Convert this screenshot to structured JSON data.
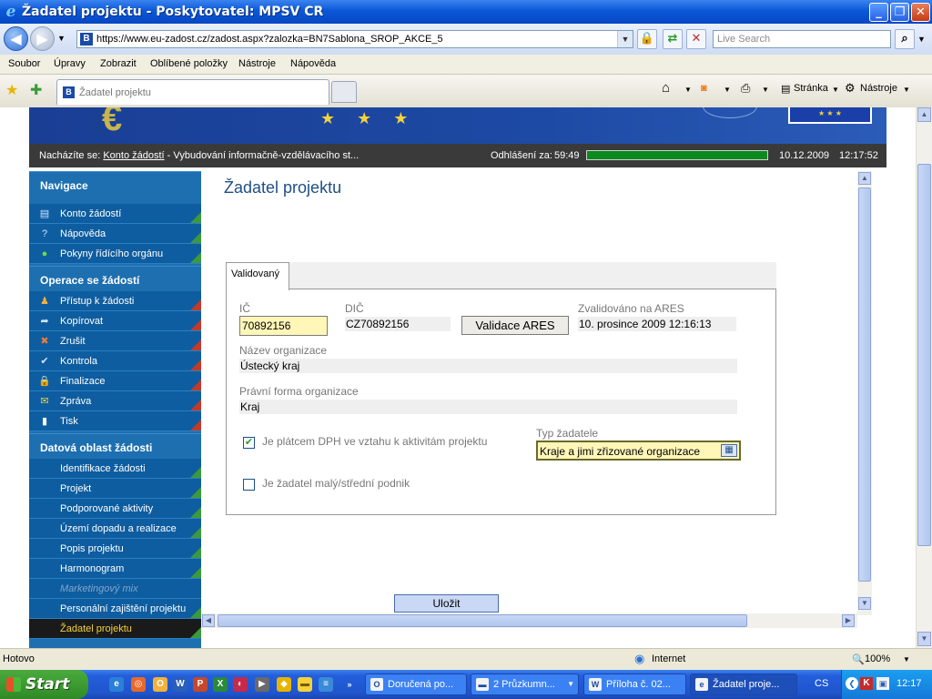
{
  "window": {
    "title": "Žadatel projektu - Poskytovatel: MPSV CR"
  },
  "address": {
    "url": "https://www.eu-zadost.cz/zadost.aspx?zalozka=BN7Sablona_SROP_AKCE_5",
    "search_placeholder": "Live Search"
  },
  "menu": [
    "Soubor",
    "Úpravy",
    "Zobrazit",
    "Oblíbené položky",
    "Nástroje",
    "Nápověda"
  ],
  "tab": {
    "title": "Žadatel projektu"
  },
  "toolbar": {
    "page_label": "Stránka",
    "tools_label": "Nástroje"
  },
  "strip": {
    "prefix": "Nacházíte se:",
    "crumb_link": "Konto žádostí",
    "crumb_rest": "- Vybudování informačně-vzdělávacího st...",
    "logout_label": "Odhlášení za:",
    "logout_value": "59:49",
    "date": "10.12.2009",
    "time": "12:17:52"
  },
  "sidebar": {
    "sections": [
      {
        "title": "Navigace",
        "items": [
          "Konto žádostí",
          "Nápověda",
          "Pokyny řídícího orgánu"
        ]
      },
      {
        "title": "Operace se žádostí",
        "items": [
          "Přístup k žádosti",
          "Kopírovat",
          "Zrušit",
          "Kontrola",
          "Finalizace",
          "Zpráva",
          "Tisk"
        ]
      },
      {
        "title": "Datová oblast žádosti",
        "items": [
          "Identifikace žádosti",
          "Projekt",
          "Podporované aktivity",
          "Území dopadu a realizace",
          "Popis projektu",
          "Harmonogram",
          "Marketingový mix",
          "Personální zajištění projektu",
          "Žadatel projektu"
        ]
      }
    ]
  },
  "page": {
    "title": "Žadatel projektu",
    "tab_label": "Validovaný",
    "ic_label": "IČ",
    "ic_value": "70892156",
    "dic_label": "DIČ",
    "dic_value": "CZ70892156",
    "ares_button": "Validace ARES",
    "validated_label": "Zvalidováno na ARES",
    "validated_value": "10. prosince 2009 12:16:13",
    "org_name_label": "Název organizace",
    "org_name_value": "Ústecký kraj",
    "legal_form_label": "Právní forma organizace",
    "legal_form_value": "Kraj",
    "dph_label": "Je plátcem DPH ve vztahu k aktivitám projektu",
    "dph_checked": true,
    "type_label": "Typ žadatele",
    "type_value": "Kraje a jimi zřizované organizace",
    "sme_label": "Je žadatel malý/střední podnik",
    "sme_checked": false,
    "save_button": "Uložit"
  },
  "statusbar": {
    "left": "Hotovo",
    "zone": "Internet",
    "zoom": "100%"
  },
  "taskbar": {
    "start": "Start",
    "tasks": [
      "Doručená po...",
      "2 Průzkumn...",
      "Příloha č. 02...",
      "Žadatel proje..."
    ],
    "lang": "CS",
    "clock": "12:17"
  },
  "colors": {
    "accent": "#1d6fb0",
    "title_blue": "#1f4f86",
    "progress": "#0b8a1e",
    "required_field": "#fff6b8"
  }
}
